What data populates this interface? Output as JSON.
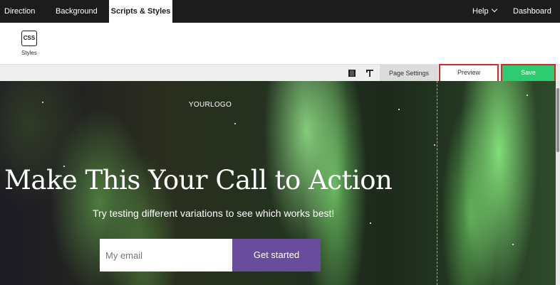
{
  "nav": {
    "tabs": [
      {
        "label": "Direction"
      },
      {
        "label": "Background"
      },
      {
        "label": "Scripts & Styles",
        "active": true
      }
    ],
    "help_label": "Help",
    "dashboard_label": "Dashboard"
  },
  "toolbar": {
    "css_icon_text": "CSS",
    "css_label": "Styles"
  },
  "actions": {
    "page_settings_label": "Page Settings",
    "preview_label": "Preview",
    "save_label": "Save"
  },
  "page": {
    "logo": "YOURLOGO",
    "headline": "Make This Your Call to Action",
    "subheadline": "Try testing different variations to see which works best!",
    "email_placeholder": "My email",
    "cta_label": "Get started"
  },
  "colors": {
    "topbar": "#1c1c1c",
    "save": "#2ecc71",
    "cta": "#6a4c9c",
    "highlight": "#d42a2a"
  }
}
